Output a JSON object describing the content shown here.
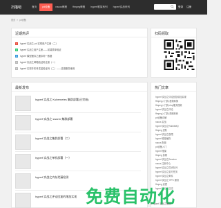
{
  "header": {
    "logo": "扫描吧",
    "nav": [
      {
        "label": "首页",
        "active": false
      },
      {
        "label": "pd设备",
        "active": true
      },
      {
        "label": "nacos教程",
        "active": false
      },
      {
        "label": "ffmpeg教程",
        "active": false
      },
      {
        "label": "hyperf框架系列",
        "active": false
      },
      {
        "label": "hyperf实战系列",
        "active": false
      }
    ],
    "login": "登录",
    "register": "注册"
  },
  "breadcrumb": {
    "home": "首页",
    "current": "pd设备",
    "separator": "»"
  },
  "recent": {
    "title": "近期热评",
    "items": [
      {
        "num": "1",
        "text": "hyperf 实战之 pd 实现用户注册（二）"
      },
      {
        "num": "2",
        "text": "hyperf 实战之用户注册——前端表单验证"
      },
      {
        "num": "3",
        "text": "hyperf 模型缓存之缓存同一数据"
      },
      {
        "num": "4",
        "text": "hyperf 实战之邮箱验证码注册（一）"
      },
      {
        "num": "5",
        "text": "hyperf 实现手机号发送验证码（二）——高德服务使用"
      }
    ]
  },
  "latest": {
    "title": "最新发布",
    "items": [
      "hyperf 实战之 Kubernetes 集群部署(已完结)",
      "hyperf 实战之 swarm 集群部署",
      "hyperf 实战之集群部署（二）",
      "hyperf 实战之单机部署（一）",
      "hyperf 实战之内存泄漏检测",
      "hyperf 实战之评论回复的增加实现"
    ]
  },
  "qr_panel": {
    "title": "扫码领取"
  },
  "hot": {
    "title": "热门文章",
    "items": [
      "hyperf 实战之评论回复增加实现",
      "ffmpeg入门篇-音频转换",
      "ffmpeg入门篇-rtsp推流视频",
      "hyperf 实战之评论",
      "ffmpeg入门篇-视频转码",
      "pd设备详解",
      "nacos 实战",
      "hyperf 实战之RabbitMQ",
      "ffmpeg 进阶",
      "hyperf 实战之权限",
      "hyperf 模型缓存",
      "nacos 配置",
      "pd设备入门",
      "hyperf 框架",
      "ffmpeg 剪辑",
      "hyperf 实战之Session",
      "nacos 注册中心",
      "hyperf 实战之异步队列",
      "hyperf 实战之定时任务",
      "hyperf 实战之邮件",
      "hyperf 实战之 RPC 服务",
      "ffmpeg 滤镜",
      "hyperf 实战之日志"
    ]
  },
  "ad": {
    "headline": "免费自动化",
    "sub": "E hyperf 实战之缓存"
  },
  "colors": {
    "topbar": "#2d2d2d",
    "accent": "#ff5e52",
    "ad_green": "#29c169"
  },
  "icons": {
    "search": "search-icon"
  }
}
